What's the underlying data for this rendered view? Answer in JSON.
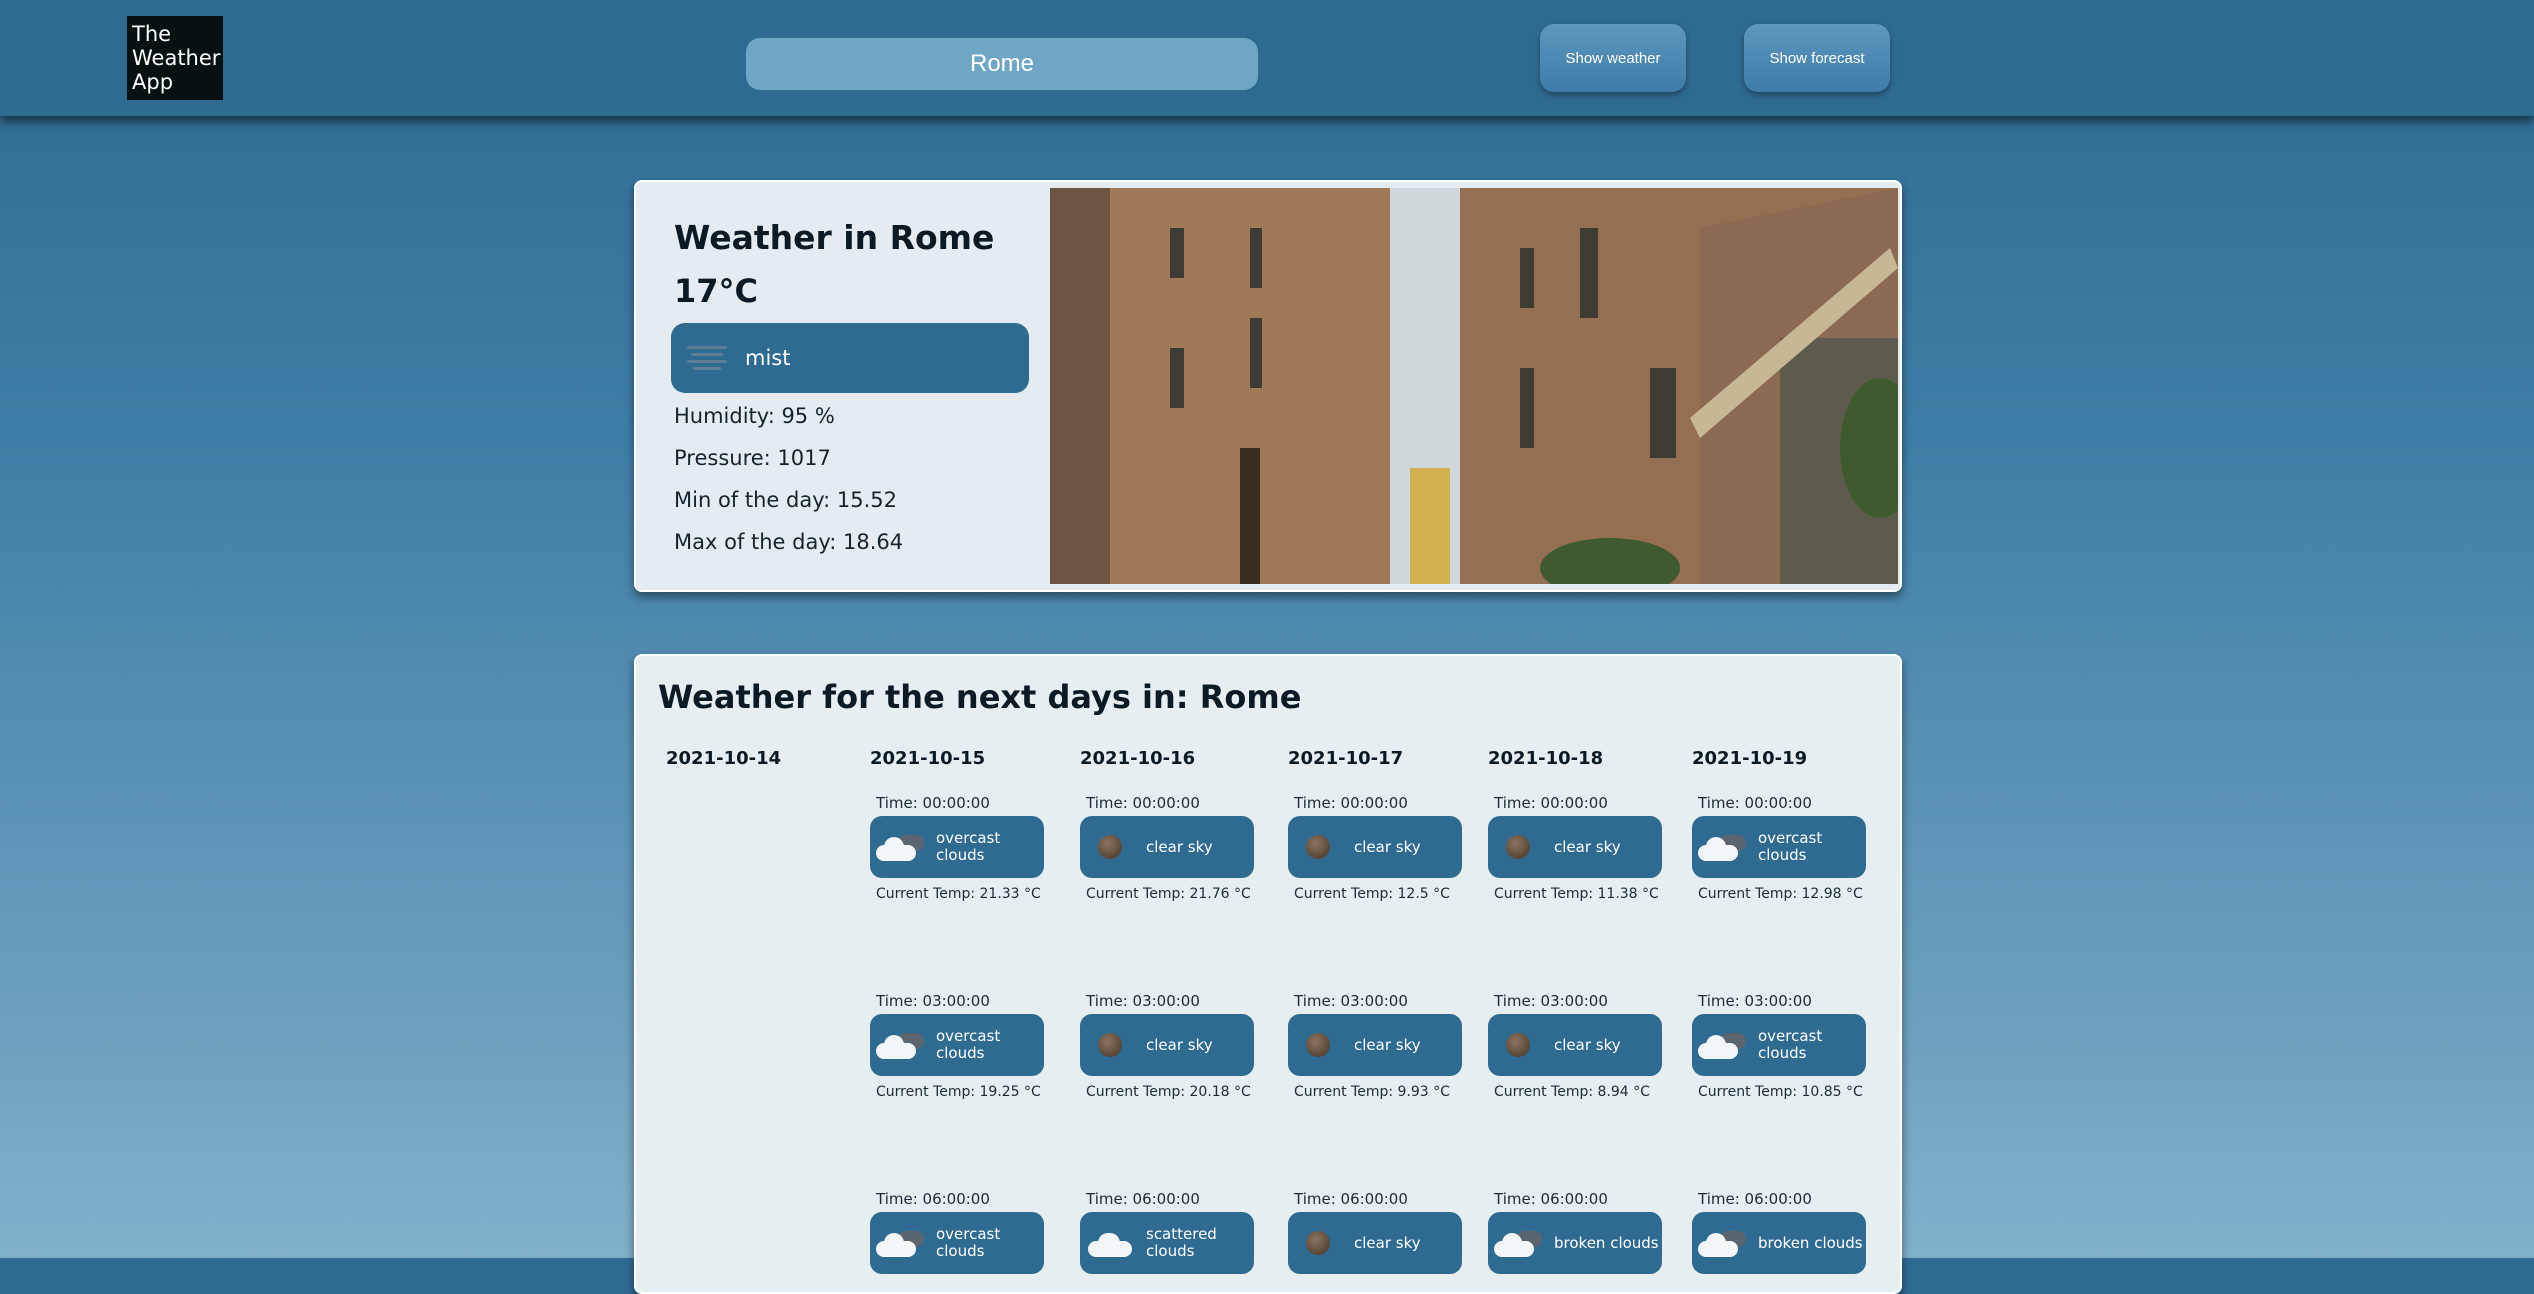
{
  "header": {
    "logo_lines": [
      "The",
      "Weather",
      "App"
    ],
    "search_value": "Rome",
    "show_weather": "Show weather",
    "show_forecast": "Show forecast"
  },
  "current": {
    "title": "Weather in Rome",
    "temp": "17°C",
    "description": "mist",
    "icon": "mist-icon",
    "humidity": "Humidity: 95 %",
    "pressure": "Pressure: 1017",
    "min": "Min of the day: 15.52",
    "max": "Max of the day: 18.64"
  },
  "forecast": {
    "title": "Weather for the next days in: Rome",
    "days": [
      "2021-10-14",
      "2021-10-15",
      "2021-10-16",
      "2021-10-17",
      "2021-10-18",
      "2021-10-19"
    ],
    "columns": [
      {
        "slots": [
          {
            "time": "Time: 00:00:00",
            "desc": "overcast clouds",
            "icon": "overcast-clouds-icon",
            "temp": "Current Temp: 21.33 °C"
          },
          {
            "time": "Time: 03:00:00",
            "desc": "overcast clouds",
            "icon": "overcast-clouds-icon",
            "temp": "Current Temp: 19.25 °C"
          },
          {
            "time": "Time: 06:00:00",
            "desc": "overcast clouds",
            "icon": "overcast-clouds-icon",
            "temp": ""
          }
        ]
      },
      {
        "slots": [
          {
            "time": "Time: 00:00:00",
            "desc": "clear sky",
            "icon": "clear-sky-night-icon",
            "temp": "Current Temp: 21.76 °C"
          },
          {
            "time": "Time: 03:00:00",
            "desc": "clear sky",
            "icon": "clear-sky-night-icon",
            "temp": "Current Temp: 20.18 °C"
          },
          {
            "time": "Time: 06:00:00",
            "desc": "scattered clouds",
            "icon": "scattered-clouds-icon",
            "temp": ""
          }
        ]
      },
      {
        "slots": [
          {
            "time": "Time: 00:00:00",
            "desc": "clear sky",
            "icon": "clear-sky-night-icon",
            "temp": "Current Temp: 12.5 °C"
          },
          {
            "time": "Time: 03:00:00",
            "desc": "clear sky",
            "icon": "clear-sky-night-icon",
            "temp": "Current Temp: 9.93 °C"
          },
          {
            "time": "Time: 06:00:00",
            "desc": "clear sky",
            "icon": "clear-sky-night-icon",
            "temp": ""
          }
        ]
      },
      {
        "slots": [
          {
            "time": "Time: 00:00:00",
            "desc": "clear sky",
            "icon": "clear-sky-night-icon",
            "temp": "Current Temp: 11.38 °C"
          },
          {
            "time": "Time: 03:00:00",
            "desc": "clear sky",
            "icon": "clear-sky-night-icon",
            "temp": "Current Temp: 8.94 °C"
          },
          {
            "time": "Time: 06:00:00",
            "desc": "broken clouds",
            "icon": "broken-clouds-icon",
            "temp": ""
          }
        ]
      },
      {
        "slots": [
          {
            "time": "Time: 00:00:00",
            "desc": "overcast clouds",
            "icon": "overcast-clouds-icon",
            "temp": "Current Temp: 12.98 °C"
          },
          {
            "time": "Time: 03:00:00",
            "desc": "overcast clouds",
            "icon": "overcast-clouds-icon",
            "temp": "Current Temp: 10.85 °C"
          },
          {
            "time": "Time: 06:00:00",
            "desc": "broken clouds",
            "icon": "broken-clouds-icon",
            "temp": ""
          }
        ]
      }
    ]
  },
  "colors": {
    "header_bg": "#2f6a90",
    "pill_bg": "#2f6a91",
    "card_bg": "#e4ecf2"
  }
}
